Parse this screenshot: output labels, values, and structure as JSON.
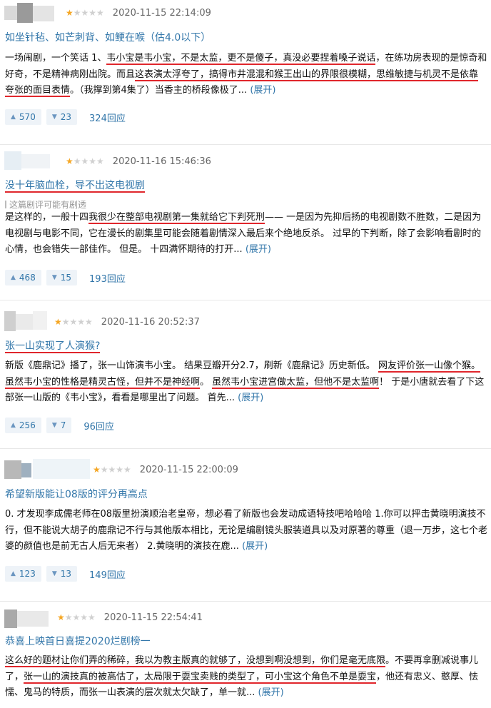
{
  "reviews": [
    {
      "rating": 1,
      "stars": {
        "on": "★",
        "off": "★★★★"
      },
      "date": "2020-11-15 22:14:09",
      "title": "如坐针毡、如芒刺背、如鲠在喉（估4.0以下）",
      "body": {
        "p1": "一场闹剧，一个笑话 1、",
        "u1": "韦小宝是韦小宝，不是太监，更不是傻子，真没必要捏着嗓子说话",
        "p2": "，在练功房表现的是惊奇和好奇，不是精神病刚出院。而且",
        "u2": "这表演太浮夸了，搞得市井混混和猴王出山的界限很模糊，思维敏捷与机灵不是依靠夸张的面目表情",
        "p3": "。（我撑到第4集了）当香主的桥段像极了...",
        "expand": "(展开)"
      },
      "up": "570",
      "down": "23",
      "replies": "324回应"
    },
    {
      "rating": 1,
      "stars": {
        "on": "★",
        "off": "★★★★"
      },
      "date": "2020-11-16 15:46:36",
      "title": "没十年脑血栓，导不出这电视剧",
      "note": "这篇剧评可能有剧透",
      "body": {
        "p1": "是这样的，一般十四",
        "u1": "我很少在整部电视剧第一集就给它下判死刑",
        "p2": "—— 一是因为先抑后扬的电视剧数不胜数，二是因为电视剧与电影不同，它在漫长的剧集里可能会随着剧情深入最后来个绝地反杀。 过早的下判断，除了会影响看剧时的心情，也会错失一部佳作。 但是。 十四满怀期待的打开...",
        "expand": "(展开)"
      },
      "up": "468",
      "down": "15",
      "replies": "193回应"
    },
    {
      "rating": 1,
      "stars": {
        "on": "★",
        "off": "★★★★"
      },
      "date": "2020-11-16 20:52:37",
      "title": "张一山实现了人演猴?",
      "body": {
        "p1": "新版《鹿鼎记》播了，张一山饰演韦小宝。 结果豆瓣开分2.7，刷新《鹿鼎记》历史新低。 ",
        "u1": "网友评价张一山像个猴。 虽然韦小宝的性格是精灵古怪，但并不是神经啊",
        "p2": "。 ",
        "u2": "虽然韦小宝进宫做太监，但他不是太监啊",
        "p3": "！ 于是小唐就去看了下这部张一山版的《韦小宝》，看看是哪里出了问题。 首先...",
        "expand": "(展开)"
      },
      "up": "256",
      "down": "7",
      "replies": "96回应"
    },
    {
      "rating": 1,
      "stars": {
        "on": "★",
        "off": "★★★★"
      },
      "date": "2020-11-15 22:00:09",
      "title": "希望新版能让08版的评分再高点",
      "body": {
        "p1": "0. 才发现李成儒老师在08版里扮演顺治老皇帝，想必看了新版也会发动成语特技吧哈哈哈 1.你可以抨击黄晓明演技不行，但不能说大胡子的鹿鼎记不行与其他版本相比，无论是编剧镜头服装道具以及对原著的尊重（退一万步，这七个老婆的颜值也是前无古人后无来者） 2.黄晓明的演技在鹿...",
        "expand": "(展开)"
      },
      "up": "123",
      "down": "13",
      "replies": "149回应"
    },
    {
      "rating": 1,
      "stars": {
        "on": "★",
        "off": "★★★★"
      },
      "date": "2020-11-15 22:54:41",
      "title": "恭喜上映首日喜提2020烂剧榜一",
      "body": {
        "u1": "这么好的题材让你们弄的稀碎，我以为教主版真的就够了，没想到啊没想到，你们是毫无底限",
        "p1": "。不要再拿删减说事儿了，",
        "u2": "张一山的演技真的被高估了，太局限于耍宝卖贱的类型了，可小宝这个角色不单是耍宝",
        "p2": "，他还有忠义、憨厚、怯懦、鬼马的特质，而张一山表演的层次就太欠缺了，单一就...",
        "expand": "(展开)"
      }
    }
  ],
  "colors": {
    "link": "#3377aa",
    "underline": "#e0262c",
    "star": "#f5a623",
    "vote_bg": "#eef3f8"
  },
  "icons": {
    "up": "triangle-up-icon",
    "down": "triangle-down-icon"
  }
}
